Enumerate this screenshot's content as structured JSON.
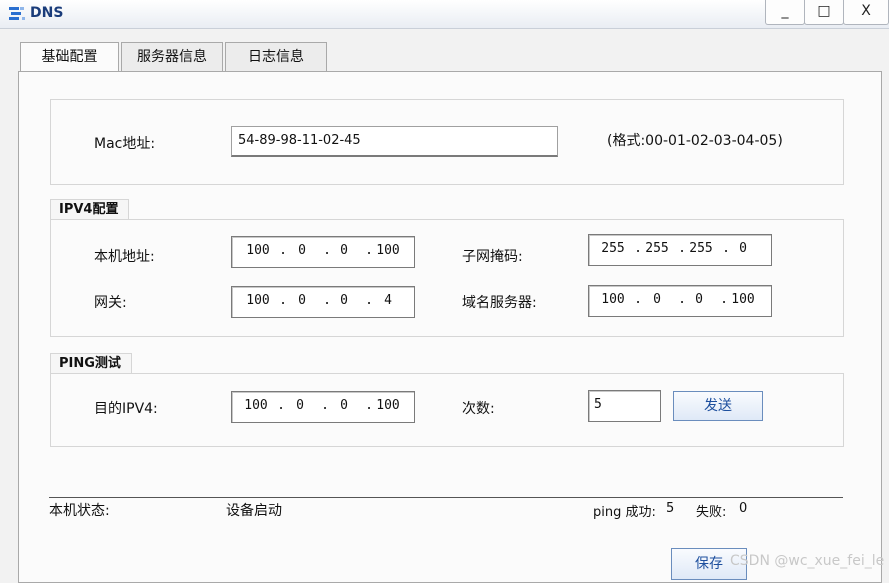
{
  "window": {
    "title": "DNS",
    "minimize": "_",
    "maximize": "□",
    "close": "X"
  },
  "tabs": [
    "基础配置",
    "服务器信息",
    "日志信息"
  ],
  "mac": {
    "label": "Mac地址:",
    "value": "54-89-98-11-02-45",
    "format_hint": "(格式:00-01-02-03-04-05)"
  },
  "ipv4": {
    "group_title": "IPV4配置",
    "local_addr_label": "本机地址:",
    "local_addr": [
      "100",
      "0",
      "0",
      "100"
    ],
    "subnet_label": "子网掩码:",
    "subnet": [
      "255",
      "255",
      "255",
      "0"
    ],
    "gateway_label": "网关:",
    "gateway": [
      "100",
      "0",
      "0",
      "4"
    ],
    "dns_label": "域名服务器:",
    "dns": [
      "100",
      "0",
      "0",
      "100"
    ]
  },
  "ping": {
    "group_title": "PING测试",
    "target_label": "目的IPV4:",
    "target": [
      "100",
      "0",
      "0",
      "100"
    ],
    "count_label": "次数:",
    "count": "5",
    "send_button": "发送"
  },
  "status": {
    "label": "本机状态:",
    "value": "设备启动",
    "ping_success_label": "ping 成功:",
    "ping_success": "5",
    "fail_label": "失败:",
    "fail": "0"
  },
  "save_button": "保存",
  "watermark": "CSDN @wc_xue_fei_le"
}
